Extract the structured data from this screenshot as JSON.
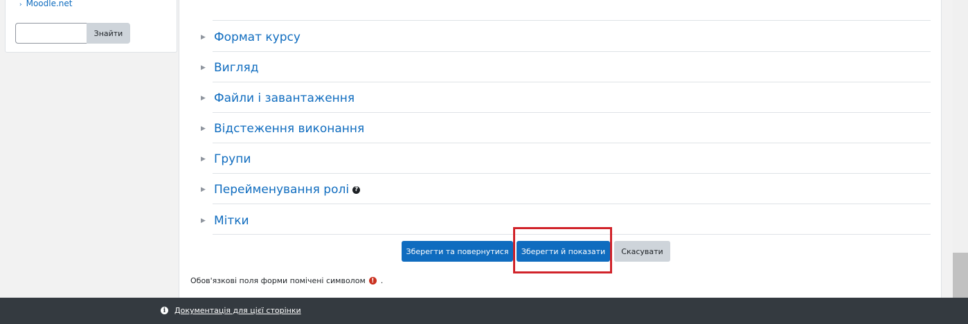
{
  "sidebar": {
    "cut_link": "Moodle.net",
    "search_button": "Знайти",
    "search_value": ""
  },
  "sections": [
    {
      "label": "Формат курсу"
    },
    {
      "label": "Вигляд"
    },
    {
      "label": "Файли і завантаження"
    },
    {
      "label": "Відстеження виконання"
    },
    {
      "label": "Групи"
    },
    {
      "label": "Перейменування ролі"
    },
    {
      "label": "Мітки"
    }
  ],
  "buttons": {
    "save_return": "Зберегти та повернутися",
    "save_display": "Зберегти й показати",
    "cancel": "Скасувати"
  },
  "required_note": "Обов'язкові поля форми помічені символом",
  "required_note_end": ".",
  "footer": {
    "doc_link": "Документація для цієї сторінки"
  },
  "colors": {
    "link": "#0f6cbf",
    "primary": "#0f6cbf",
    "highlight": "#d1232a",
    "footer_bg": "#343a40"
  }
}
